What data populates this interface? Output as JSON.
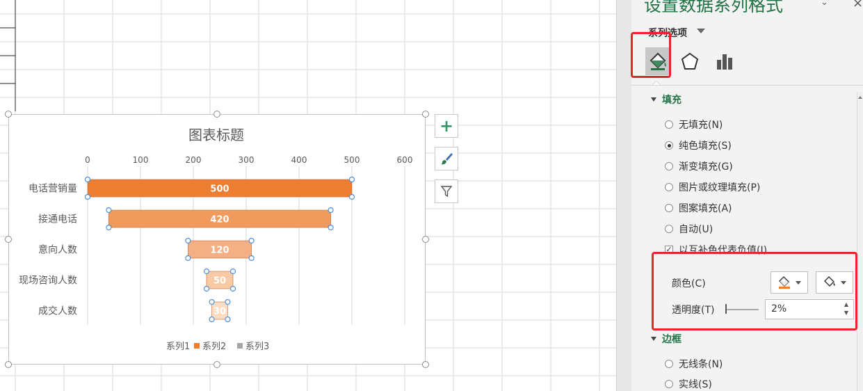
{
  "chart_data": {
    "type": "bar",
    "orientation": "horizontal",
    "title": "图表标题",
    "categories": [
      "电话营销量",
      "接通电话",
      "意向人数",
      "现场咨询人数",
      "成交人数"
    ],
    "series": [
      {
        "name": "系列1",
        "values": [
          0,
          40,
          190,
          225,
          235
        ],
        "color": "#ffffff"
      },
      {
        "name": "系列2",
        "values": [
          500,
          420,
          120,
          50,
          30
        ],
        "colors": [
          "#ed7d31",
          "#f09a5e",
          "#f4b084",
          "#f8caa6",
          "#fbdcc4"
        ]
      },
      {
        "name": "系列3",
        "values": [
          0,
          0,
          0,
          0,
          0
        ],
        "color": "#a5a5a5"
      }
    ],
    "data_labels": [
      "500",
      "420",
      "120",
      "50",
      "30"
    ],
    "x_ticks": [
      "0",
      "100",
      "200",
      "300",
      "400",
      "500",
      "600"
    ],
    "xlim": [
      0,
      600
    ],
    "grid": true,
    "axis_position": "top",
    "legend_position": "bottom",
    "legend": [
      "系列1",
      "系列2",
      "系列3"
    ]
  },
  "chart_tools": {
    "add_element": "+",
    "styles": "brush-icon",
    "filters": "filter-icon"
  },
  "pane": {
    "title": "设置数据系列格式",
    "close": "×",
    "series_options": "系列选项",
    "tabs": [
      "fill-line-icon",
      "effects-icon",
      "series-options-icon"
    ],
    "fill_section": "填充",
    "fill_options": [
      {
        "label": "无填充(N)",
        "selected": false
      },
      {
        "label": "纯色填充(S)",
        "selected": true
      },
      {
        "label": "渐变填充(G)",
        "selected": false
      },
      {
        "label": "图片或纹理填充(P)",
        "selected": false
      },
      {
        "label": "图案填充(A)",
        "selected": false
      },
      {
        "label": "自动(U)",
        "selected": false
      }
    ],
    "invert_label": "以互补色代表负值(I)",
    "invert_checked": true,
    "color_label": "颜色(C)",
    "transparency_label": "透明度(T)",
    "transparency_value": "2%",
    "transparency": 0.02,
    "border_section": "边框",
    "border_options": [
      {
        "label": "无线条(N)",
        "selected": false
      },
      {
        "label": "实线(S)",
        "selected": false
      }
    ],
    "accent_color": "#217346",
    "highlight_color": "#e8262a"
  }
}
